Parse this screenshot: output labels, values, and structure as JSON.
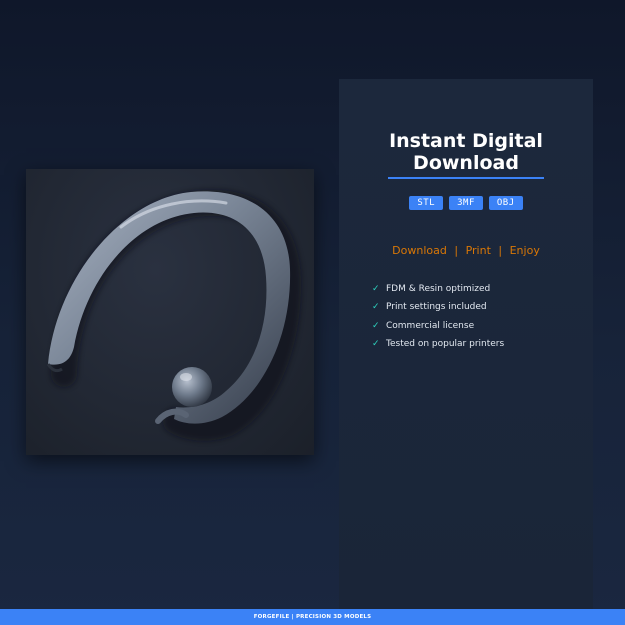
{
  "panel": {
    "title_line1": "Instant Digital",
    "title_line2": "Download",
    "formats": [
      "STL",
      "3MF",
      "OBJ"
    ],
    "tagline": [
      "Download",
      "Print",
      "Enjoy"
    ],
    "tagline_separator": "|",
    "features": [
      "FDM & Resin optimized",
      "Print settings included",
      "Commercial license",
      "Tested on popular printers"
    ],
    "check_glyph": "✓"
  },
  "footer": {
    "text": "FORGEFILE | PRECISION 3D MODELS"
  },
  "colors": {
    "accent": "#3b82f6",
    "tagline": "#d97706",
    "check": "#2dd4bf"
  },
  "model": {
    "icon": "horn-earring-render"
  }
}
